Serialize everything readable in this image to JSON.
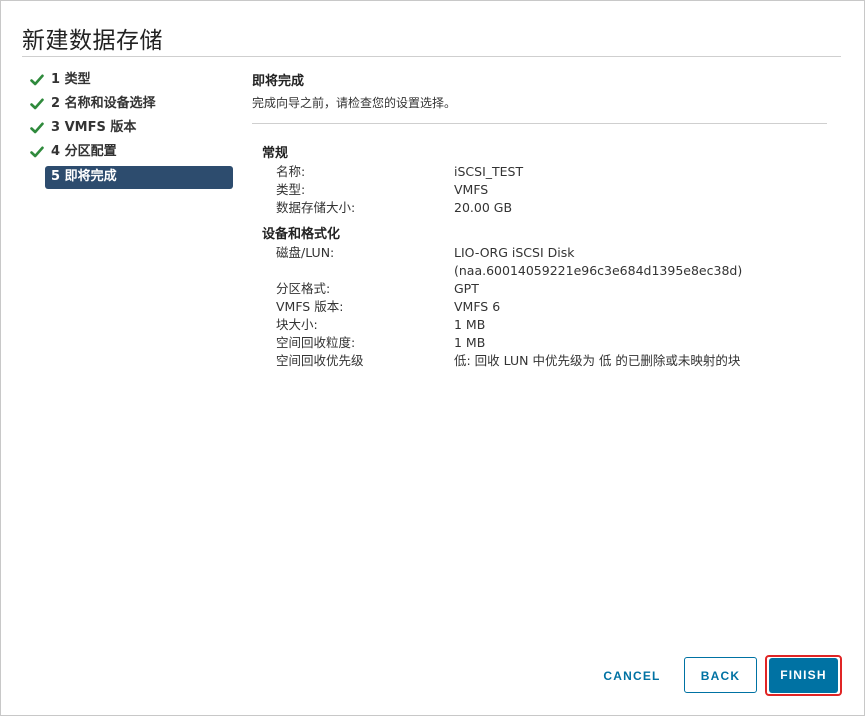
{
  "dialog": {
    "title": "新建数据存储"
  },
  "steps": [
    {
      "label": "1 类型",
      "done": true
    },
    {
      "label": "2 名称和设备选择",
      "done": true
    },
    {
      "label": "3 VMFS 版本",
      "done": true
    },
    {
      "label": "4 分区配置",
      "done": true
    },
    {
      "label": "5 即将完成",
      "done": false,
      "active": true
    }
  ],
  "content": {
    "heading": "即将完成",
    "subtitle": "完成向导之前，请检查您的设置选择。",
    "general": {
      "title": "常规",
      "rows": [
        {
          "k": "名称:",
          "v": "iSCSI_TEST"
        },
        {
          "k": "类型:",
          "v": "VMFS"
        },
        {
          "k": "数据存储大小:",
          "v": "20.00 GB"
        }
      ]
    },
    "device": {
      "title": "设备和格式化",
      "rows": [
        {
          "k": "磁盘/LUN:",
          "v": "LIO-ORG iSCSI Disk"
        },
        {
          "k": "",
          "v": "(naa.60014059221e96c3e684d1395e8ec38d)"
        },
        {
          "k": "分区格式:",
          "v": "GPT"
        },
        {
          "k": "VMFS 版本:",
          "v": "VMFS 6"
        },
        {
          "k": "块大小:",
          "v": "1 MB"
        },
        {
          "k": "空间回收粒度:",
          "v": "1 MB"
        },
        {
          "k": "空间回收优先级",
          "v": "低: 回收 LUN 中优先级为 低 的已删除或未映射的块"
        }
      ]
    }
  },
  "buttons": {
    "cancel": "CANCEL",
    "back": "BACK",
    "finish": "FINISH"
  },
  "colors": {
    "primary": "#0072a3",
    "active_step": "#2d4c6e",
    "check": "#2f8a3c",
    "highlight": "#e02525"
  }
}
